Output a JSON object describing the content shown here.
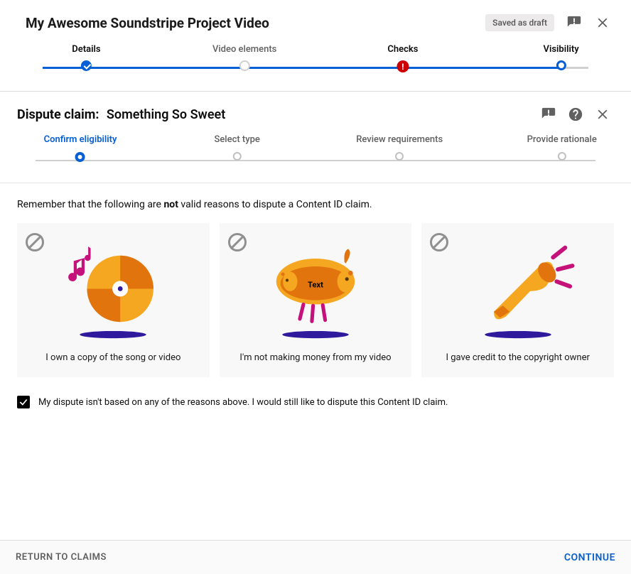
{
  "header": {
    "title": "My Awesome Soundstripe Project Video",
    "saved_badge": "Saved as draft"
  },
  "upload_steps": [
    {
      "label": "Details",
      "state": "done",
      "pos": 8
    },
    {
      "label": "Video elements",
      "state": "idle",
      "pos": 37
    },
    {
      "label": "Checks",
      "state": "error",
      "pos": 66
    },
    {
      "label": "Visibility",
      "state": "current",
      "pos": 95
    }
  ],
  "upload_track_active_to": 95,
  "dispute": {
    "title_prefix": "Dispute claim:",
    "title_song": "Something So Sweet",
    "steps": [
      {
        "label": "Confirm eligibility",
        "active": true,
        "pos": 8
      },
      {
        "label": "Select type",
        "active": false,
        "pos": 36
      },
      {
        "label": "Review requirements",
        "active": false,
        "pos": 65
      },
      {
        "label": "Provide rationale",
        "active": false,
        "pos": 94
      }
    ],
    "reminder_pre": "Remember that the following are ",
    "reminder_bold": "not",
    "reminder_post": " valid reasons to dispute a Content ID claim.",
    "cards": [
      {
        "caption": "I own a copy of the song or video",
        "illus": "disc",
        "icon_name": "disc-music-illustration"
      },
      {
        "caption": "I'm not making money from my video",
        "illus": "piggy",
        "icon_name": "piggy-bank-illustration",
        "overlay_text": "Text"
      },
      {
        "caption": "I gave credit to the copyright owner",
        "illus": "megaphone",
        "icon_name": "megaphone-illustration"
      }
    ],
    "checkbox_label": "My dispute isn't based on any of the reasons above. I would still like to dispute this Content ID claim.",
    "checkbox_checked": true
  },
  "footer": {
    "return": "RETURN TO CLAIMS",
    "continue": "CONTINUE"
  },
  "colors": {
    "primary": "#065fd4",
    "error": "#cc0000",
    "accent_orange": "#f5a721",
    "accent_orange_dark": "#e2740e",
    "accent_magenta": "#c5117a",
    "accent_purple": "#2f1a9e"
  }
}
